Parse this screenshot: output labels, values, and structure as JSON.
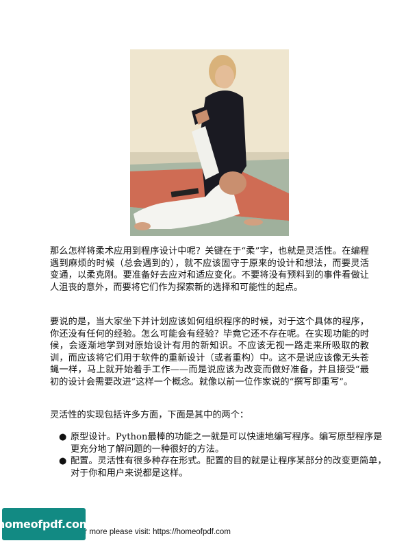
{
  "paragraphs": [
    "那么怎样将柔术应用到程序设计中呢？关键在于“柔”字，也就是灵活性。在编程遇到麻烦的时候（总会遇到的），就不应该固守于原来的设计和想法，而要灵活变通，以柔克刚。要准备好去应对和适应变化。不要将没有预料到的事件看做让人沮丧的意外，而要将它们作为探索新的选择和可能性的起点。",
    "要说的是，当大家坐下并计划应该如何组织程序的时候，对于这个具体的程序，你还没有任何的经验。怎么可能会有经验？毕竟它还不存在呢。在实现功能的时候，会逐渐地学到对原始设计有用的新知识。不应该无视一路走来所吸取的教训，而应该将它们用于软件的重新设计（或者重构）中。这不是说应该像无头苍蝇一样，马上就开始着手工作——而是说应该为改变而做好准备，并且接受“最初的设计会需要改进”这样一个概念。就像以前一位作家说的“撰写即重写”。",
    "灵活性的实现包括许多方面，下面是其中的两个："
  ],
  "bullets": [
    "原型设计。Python最棒的功能之一就是可以快速地编写程序。编写原型程序是更充分地了解问题的一种很好的方法。",
    "配置。灵活性有很多种存在形式。配置的目的就是让程序某部分的改变更简单，对于你和用户来说都是这样。"
  ],
  "footer": {
    "logo_text": "homeofpdf.com",
    "note": "For more please visit: https://homeofpdf.com"
  },
  "colors": {
    "logo_bg": "#128a83"
  }
}
